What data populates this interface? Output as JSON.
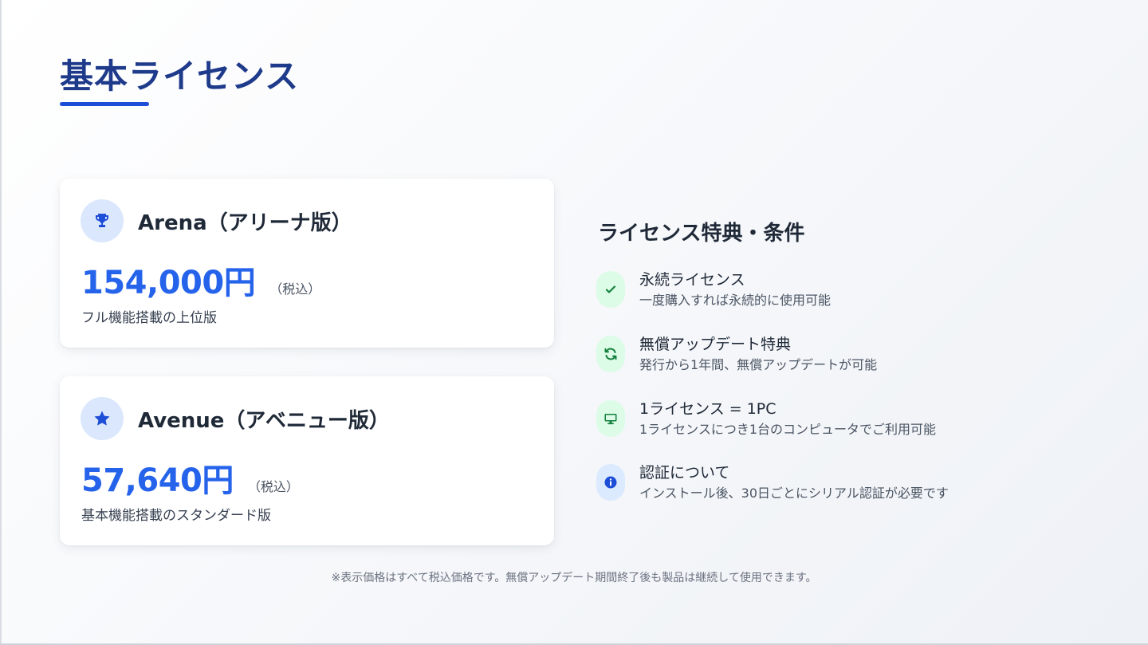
{
  "header": {
    "title": "基本ライセンス"
  },
  "cards": [
    {
      "icon": "trophy-icon",
      "title": "Arena（アリーナ版）",
      "price": "154,000円",
      "tax": "（税込）",
      "description": "フル機能搭載の上位版"
    },
    {
      "icon": "star-icon",
      "title": "Avenue（アベニュー版）",
      "price": "57,640円",
      "tax": "（税込）",
      "description": "基本機能搭載のスタンダード版"
    }
  ],
  "benefits": {
    "title": "ライセンス特典・条件",
    "items": [
      {
        "icon": "check-icon",
        "title": "永続ライセンス",
        "subtitle": "一度購入すれば永続的に使用可能"
      },
      {
        "icon": "refresh-icon",
        "title": "無償アップデート特典",
        "subtitle": "発行から1年間、無償アップデートが可能"
      },
      {
        "icon": "monitor-icon",
        "title": "1ライセンス = 1PC",
        "subtitle": "1ライセンスにつき1台のコンピュータでご利用可能"
      },
      {
        "icon": "info-icon",
        "title": "認証について",
        "subtitle": "インストール後、30日ごとにシリアル認証が必要です"
      }
    ]
  },
  "footnote": "※表示価格はすべて税込価格です。無償アップデート期間終了後も製品は継続して使用できます。",
  "colors": {
    "accent": "#2563eb",
    "title": "#1e3a8a",
    "green": "#16a34a",
    "icon_bg": "#dbe7fc"
  }
}
